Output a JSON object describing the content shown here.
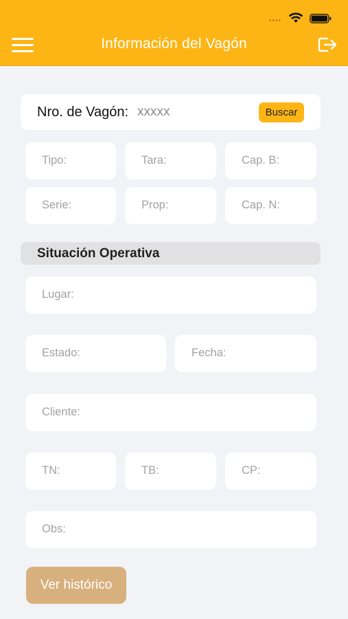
{
  "header": {
    "title": "Información del Vagón",
    "color": "#fdb515"
  },
  "search": {
    "label": "Nro. de Vagón:",
    "placeholder": "xxxxx",
    "button_label": "Buscar"
  },
  "wagon_fields": {
    "tipo": "Tipo:",
    "tara": "Tara:",
    "cap_b": "Cap. B:",
    "serie": "Serie:",
    "prop": "Prop:",
    "cap_n": "Cap. N:"
  },
  "section": {
    "title": "Situación Operativa"
  },
  "operative_fields": {
    "lugar": "Lugar:",
    "estado": "Estado:",
    "fecha": "Fecha:",
    "cliente": "Cliente:",
    "tn": "TN:",
    "tb": "TB:",
    "cp": "CP:",
    "obs": "Obs:"
  },
  "actions": {
    "history_label": "Ver histórico",
    "history_color": "#d8b07e"
  }
}
